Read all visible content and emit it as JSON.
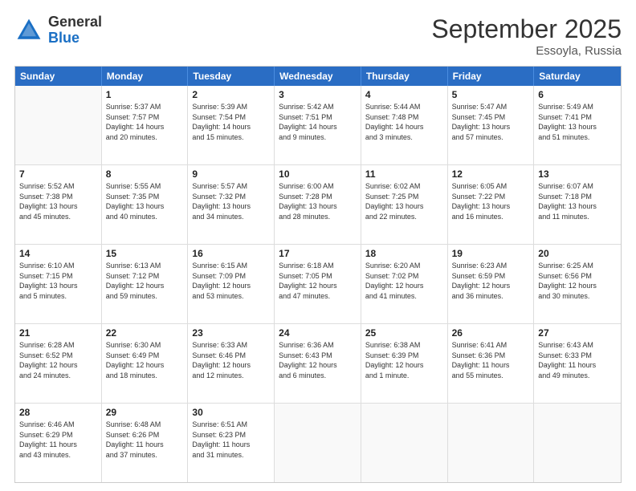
{
  "header": {
    "logo_general": "General",
    "logo_blue": "Blue",
    "month_title": "September 2025",
    "location": "Essoyla, Russia"
  },
  "days_of_week": [
    "Sunday",
    "Monday",
    "Tuesday",
    "Wednesday",
    "Thursday",
    "Friday",
    "Saturday"
  ],
  "weeks": [
    [
      {
        "day": "",
        "lines": []
      },
      {
        "day": "1",
        "lines": [
          "Sunrise: 5:37 AM",
          "Sunset: 7:57 PM",
          "Daylight: 14 hours",
          "and 20 minutes."
        ]
      },
      {
        "day": "2",
        "lines": [
          "Sunrise: 5:39 AM",
          "Sunset: 7:54 PM",
          "Daylight: 14 hours",
          "and 15 minutes."
        ]
      },
      {
        "day": "3",
        "lines": [
          "Sunrise: 5:42 AM",
          "Sunset: 7:51 PM",
          "Daylight: 14 hours",
          "and 9 minutes."
        ]
      },
      {
        "day": "4",
        "lines": [
          "Sunrise: 5:44 AM",
          "Sunset: 7:48 PM",
          "Daylight: 14 hours",
          "and 3 minutes."
        ]
      },
      {
        "day": "5",
        "lines": [
          "Sunrise: 5:47 AM",
          "Sunset: 7:45 PM",
          "Daylight: 13 hours",
          "and 57 minutes."
        ]
      },
      {
        "day": "6",
        "lines": [
          "Sunrise: 5:49 AM",
          "Sunset: 7:41 PM",
          "Daylight: 13 hours",
          "and 51 minutes."
        ]
      }
    ],
    [
      {
        "day": "7",
        "lines": [
          "Sunrise: 5:52 AM",
          "Sunset: 7:38 PM",
          "Daylight: 13 hours",
          "and 45 minutes."
        ]
      },
      {
        "day": "8",
        "lines": [
          "Sunrise: 5:55 AM",
          "Sunset: 7:35 PM",
          "Daylight: 13 hours",
          "and 40 minutes."
        ]
      },
      {
        "day": "9",
        "lines": [
          "Sunrise: 5:57 AM",
          "Sunset: 7:32 PM",
          "Daylight: 13 hours",
          "and 34 minutes."
        ]
      },
      {
        "day": "10",
        "lines": [
          "Sunrise: 6:00 AM",
          "Sunset: 7:28 PM",
          "Daylight: 13 hours",
          "and 28 minutes."
        ]
      },
      {
        "day": "11",
        "lines": [
          "Sunrise: 6:02 AM",
          "Sunset: 7:25 PM",
          "Daylight: 13 hours",
          "and 22 minutes."
        ]
      },
      {
        "day": "12",
        "lines": [
          "Sunrise: 6:05 AM",
          "Sunset: 7:22 PM",
          "Daylight: 13 hours",
          "and 16 minutes."
        ]
      },
      {
        "day": "13",
        "lines": [
          "Sunrise: 6:07 AM",
          "Sunset: 7:18 PM",
          "Daylight: 13 hours",
          "and 11 minutes."
        ]
      }
    ],
    [
      {
        "day": "14",
        "lines": [
          "Sunrise: 6:10 AM",
          "Sunset: 7:15 PM",
          "Daylight: 13 hours",
          "and 5 minutes."
        ]
      },
      {
        "day": "15",
        "lines": [
          "Sunrise: 6:13 AM",
          "Sunset: 7:12 PM",
          "Daylight: 12 hours",
          "and 59 minutes."
        ]
      },
      {
        "day": "16",
        "lines": [
          "Sunrise: 6:15 AM",
          "Sunset: 7:09 PM",
          "Daylight: 12 hours",
          "and 53 minutes."
        ]
      },
      {
        "day": "17",
        "lines": [
          "Sunrise: 6:18 AM",
          "Sunset: 7:05 PM",
          "Daylight: 12 hours",
          "and 47 minutes."
        ]
      },
      {
        "day": "18",
        "lines": [
          "Sunrise: 6:20 AM",
          "Sunset: 7:02 PM",
          "Daylight: 12 hours",
          "and 41 minutes."
        ]
      },
      {
        "day": "19",
        "lines": [
          "Sunrise: 6:23 AM",
          "Sunset: 6:59 PM",
          "Daylight: 12 hours",
          "and 36 minutes."
        ]
      },
      {
        "day": "20",
        "lines": [
          "Sunrise: 6:25 AM",
          "Sunset: 6:56 PM",
          "Daylight: 12 hours",
          "and 30 minutes."
        ]
      }
    ],
    [
      {
        "day": "21",
        "lines": [
          "Sunrise: 6:28 AM",
          "Sunset: 6:52 PM",
          "Daylight: 12 hours",
          "and 24 minutes."
        ]
      },
      {
        "day": "22",
        "lines": [
          "Sunrise: 6:30 AM",
          "Sunset: 6:49 PM",
          "Daylight: 12 hours",
          "and 18 minutes."
        ]
      },
      {
        "day": "23",
        "lines": [
          "Sunrise: 6:33 AM",
          "Sunset: 6:46 PM",
          "Daylight: 12 hours",
          "and 12 minutes."
        ]
      },
      {
        "day": "24",
        "lines": [
          "Sunrise: 6:36 AM",
          "Sunset: 6:43 PM",
          "Daylight: 12 hours",
          "and 6 minutes."
        ]
      },
      {
        "day": "25",
        "lines": [
          "Sunrise: 6:38 AM",
          "Sunset: 6:39 PM",
          "Daylight: 12 hours",
          "and 1 minute."
        ]
      },
      {
        "day": "26",
        "lines": [
          "Sunrise: 6:41 AM",
          "Sunset: 6:36 PM",
          "Daylight: 11 hours",
          "and 55 minutes."
        ]
      },
      {
        "day": "27",
        "lines": [
          "Sunrise: 6:43 AM",
          "Sunset: 6:33 PM",
          "Daylight: 11 hours",
          "and 49 minutes."
        ]
      }
    ],
    [
      {
        "day": "28",
        "lines": [
          "Sunrise: 6:46 AM",
          "Sunset: 6:29 PM",
          "Daylight: 11 hours",
          "and 43 minutes."
        ]
      },
      {
        "day": "29",
        "lines": [
          "Sunrise: 6:48 AM",
          "Sunset: 6:26 PM",
          "Daylight: 11 hours",
          "and 37 minutes."
        ]
      },
      {
        "day": "30",
        "lines": [
          "Sunrise: 6:51 AM",
          "Sunset: 6:23 PM",
          "Daylight: 11 hours",
          "and 31 minutes."
        ]
      },
      {
        "day": "",
        "lines": []
      },
      {
        "day": "",
        "lines": []
      },
      {
        "day": "",
        "lines": []
      },
      {
        "day": "",
        "lines": []
      }
    ]
  ]
}
